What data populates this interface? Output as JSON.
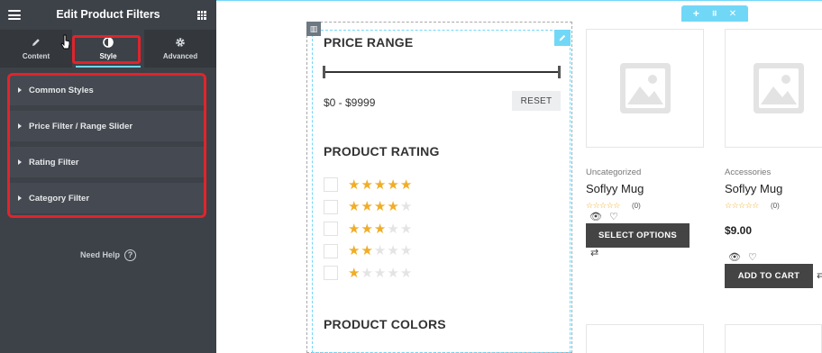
{
  "panel": {
    "title": "Edit Product Filters",
    "tabs": [
      {
        "label": "Content",
        "icon": "pencil-icon"
      },
      {
        "label": "Style",
        "icon": "contrast-icon"
      },
      {
        "label": "Advanced",
        "icon": "gear-icon"
      }
    ],
    "active_tab": "Style",
    "sections": [
      {
        "label": "Common Styles"
      },
      {
        "label": "Price Filter / Range Slider"
      },
      {
        "label": "Rating Filter"
      },
      {
        "label": "Category Filter"
      }
    ],
    "need_help": "Need Help",
    "highlight_color": "#e0242c",
    "accent_color": "#71d7f7"
  },
  "filters": {
    "price_title": "PRICE RANGE",
    "price_min": 0,
    "price_max": 9999,
    "price_text": "$0 - $9999",
    "reset_label": "RESET",
    "rating_title": "PRODUCT RATING",
    "ratings": [
      5,
      4,
      3,
      2,
      1
    ],
    "colors_title": "PRODUCT COLORS"
  },
  "products": [
    {
      "category": "Uncategorized",
      "name": "Soflyy Mug",
      "rating_count": "(0)",
      "button": "SELECT OPTIONS",
      "price": ""
    },
    {
      "category": "Accessories",
      "name": "Soflyy Mug",
      "rating_count": "(0)",
      "button": "ADD TO CART",
      "price": "$9.00"
    }
  ]
}
